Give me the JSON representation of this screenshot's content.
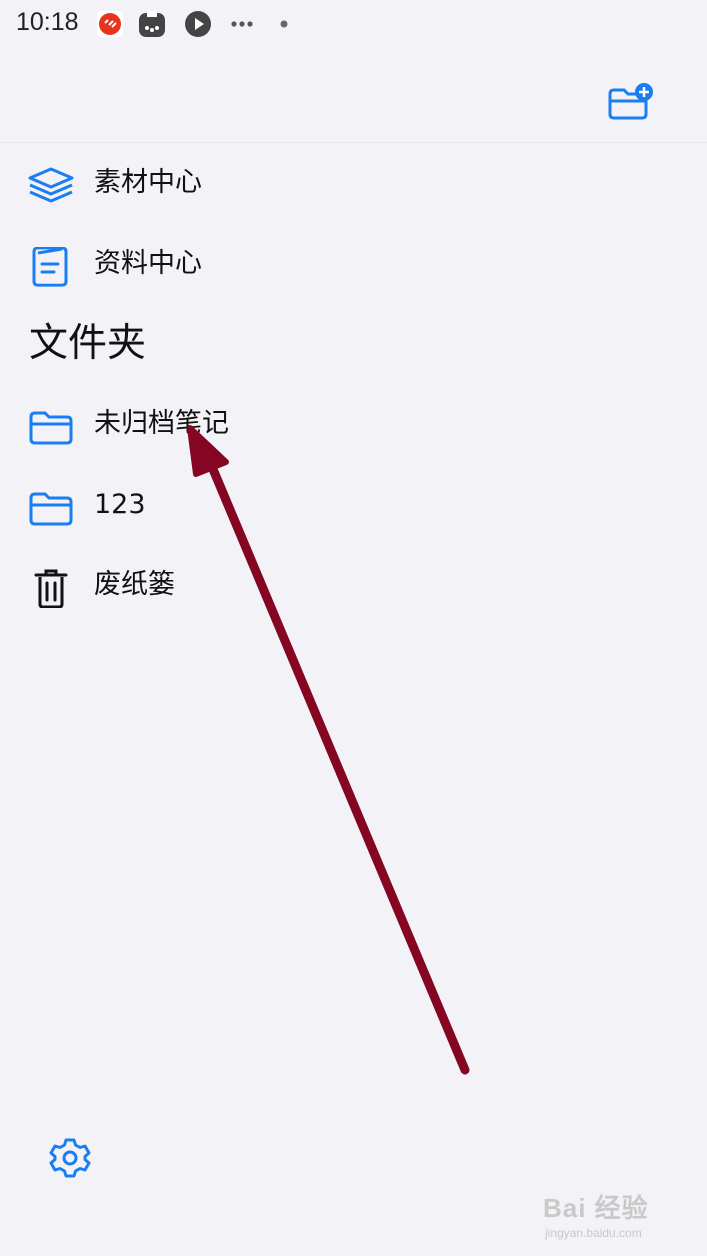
{
  "status_bar": {
    "time": "10:18",
    "icons": [
      "app-icon-red",
      "app-icon-game",
      "app-icon-play",
      "more-dots-icon",
      "dot-icon"
    ]
  },
  "toolbar": {
    "new_folder_icon": "folder-plus-icon"
  },
  "nav": [
    {
      "label": "素材中心",
      "icon": "layers-icon"
    },
    {
      "label": "资料中心",
      "icon": "document-icon"
    }
  ],
  "folders_section": {
    "title": "文件夹",
    "items": [
      {
        "label": "未归档笔记",
        "icon": "folder-icon"
      },
      {
        "label": "123",
        "icon": "folder-icon"
      },
      {
        "label": "废纸篓",
        "icon": "trash-icon"
      }
    ]
  },
  "footer": {
    "settings_icon": "gear-icon"
  },
  "watermark": {
    "text": "Bai 经验",
    "sub": "jingyan.baidu.com"
  },
  "colors": {
    "accent": "#1a7ef2",
    "background": "#f3f2f7",
    "annotation_arrow": "#850622"
  }
}
